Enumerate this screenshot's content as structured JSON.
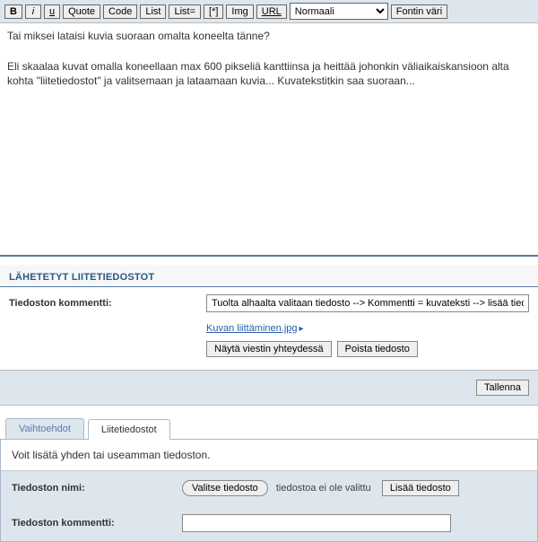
{
  "toolbar": {
    "bold": "B",
    "italic": "i",
    "underline": "u",
    "quote": "Quote",
    "code": "Code",
    "list": "List",
    "listeq": "List=",
    "bullet": "[*]",
    "img": "Img",
    "url": "URL",
    "font_size_selected": "Normaali",
    "font_color": "Fontin väri"
  },
  "editor": {
    "content": "Tai miksei lataisi kuvia suoraan omalta koneelta tänne?\n\nEli skaalaa kuvat omalla koneellaan max 600 pikseliä kanttiinsa ja heittää johonkin väliaikaiskansioon alta kohta \"liitetiedostot\" ja valitsemaan ja lataamaan kuvia... Kuvatekstitkin saa suoraan..."
  },
  "attachments": {
    "header": "LÄHETETYT LIITETIEDOSTOT",
    "comment_label": "Tiedoston kommentti:",
    "comment_value": "Tuolta alhaalta valitaan tiedosto --> Kommentti = kuvateksti --> lisää tiedosto",
    "file_name": "Kuvan liittäminen.jpg",
    "show_inline": "Näytä viestin yhteydessä",
    "remove": "Poista tiedosto"
  },
  "save": {
    "label": "Tallenna"
  },
  "tabs": {
    "options": "Vaihtoehdot",
    "attachments": "Liitetiedostot"
  },
  "panel": {
    "desc": "Voit lisätä yhden tai useamman tiedoston.",
    "filename_label": "Tiedoston nimi:",
    "choose_file": "Valitse tiedosto",
    "no_file": "tiedostoa ei ole valittu",
    "add_file": "Lisää tiedosto",
    "comment_label": "Tiedoston kommentti:",
    "comment_value": ""
  }
}
